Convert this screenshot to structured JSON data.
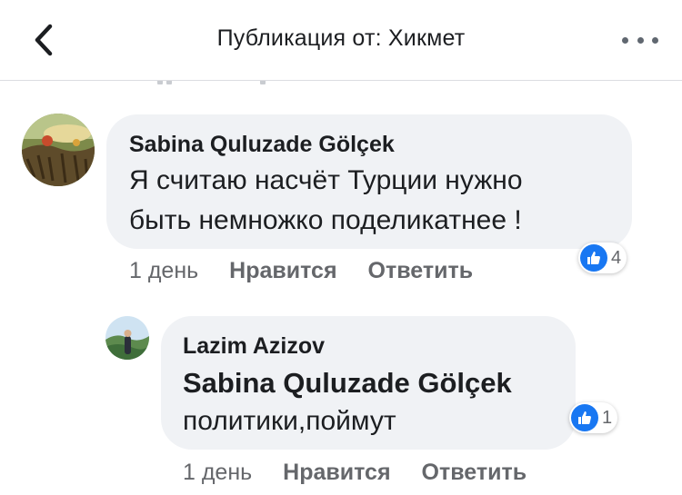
{
  "header": {
    "title": "Публикация от: Хикмет"
  },
  "comments": [
    {
      "author": "Sabina Quluzade Gölçek",
      "text_lines": [
        "Я считаю насчёт Турции нужно",
        "быть немножко поделикатнее !"
      ],
      "time": "1 день",
      "like_label": "Нравится",
      "reply_label": "Ответить",
      "reactions": "4"
    },
    {
      "author": "Lazim Azizov",
      "mention": "Sabina Quluzade Gölçek",
      "text": "политики,поймут",
      "time": "1 день",
      "like_label": "Нравится",
      "reply_label": "Ответить",
      "reactions": "1"
    }
  ]
}
